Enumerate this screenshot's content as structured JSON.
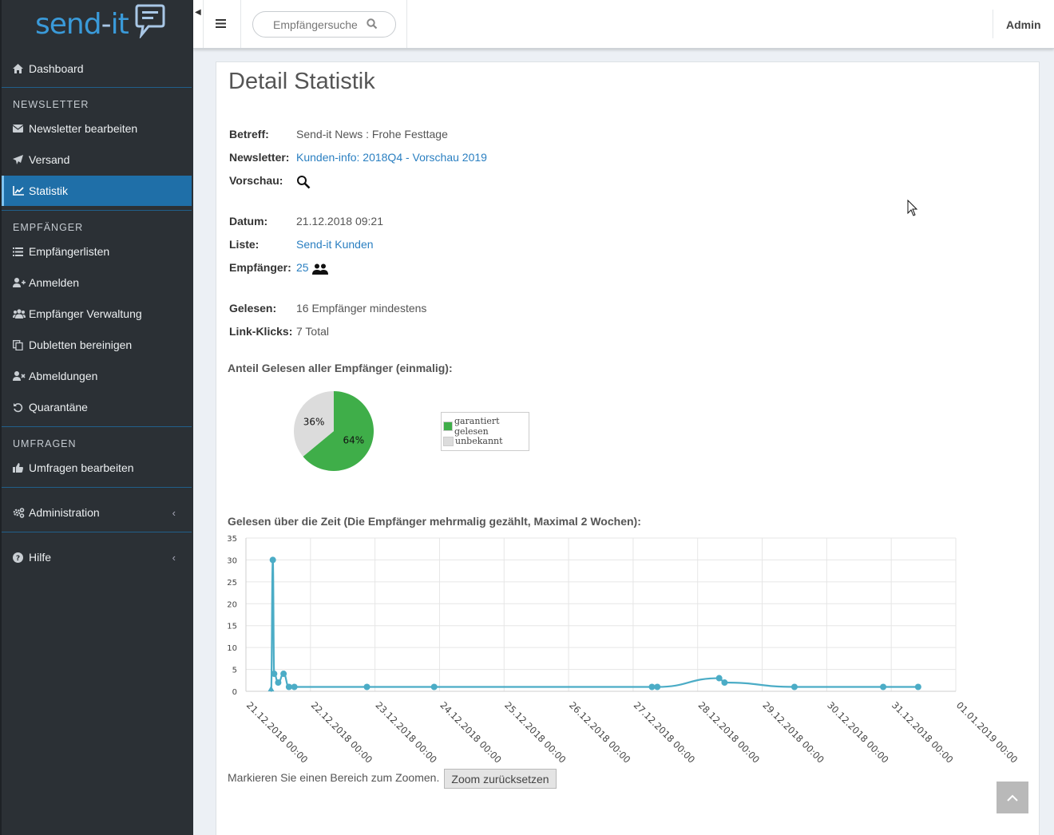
{
  "app": {
    "logo_text_a": "send",
    "logo_text_dash": "-",
    "logo_text_b": "it"
  },
  "sidebar": {
    "dashboard": "Dashboard",
    "section_newsletter": "NEWSLETTER",
    "newsletter_edit": "Newsletter bearbeiten",
    "versand": "Versand",
    "statistik": "Statistik",
    "section_empfaenger": "EMPFÄNGER",
    "empfaengerlisten": "Empfängerlisten",
    "anmelden": "Anmelden",
    "empfaenger_verwaltung": "Empfänger Verwaltung",
    "dubletten": "Dubletten bereinigen",
    "abmeldungen": "Abmeldungen",
    "quarantaene": "Quarantäne",
    "section_umfragen": "UMFRAGEN",
    "umfragen_edit": "Umfragen bearbeiten",
    "administration": "Administration",
    "hilfe": "Hilfe"
  },
  "header": {
    "search_placeholder": "Empfängersuche",
    "user": "Admin"
  },
  "detail": {
    "title": "Detail Statistik",
    "betreff_label": "Betreff:",
    "betreff": "Send-it News : Frohe Festtage",
    "newsletter_label": "Newsletter:",
    "newsletter": "Kunden-info: 2018Q4 - Vorschau 2019",
    "vorschau_label": "Vorschau:",
    "datum_label": "Datum:",
    "datum": "21.12.2018 09:21",
    "liste_label": "Liste:",
    "liste": "Send-it Kunden",
    "empfaenger_label": "Empfänger:",
    "empfaenger": "25",
    "gelesen_label": "Gelesen:",
    "gelesen": "16 Empfänger mindestens",
    "linkklicks_label": "Link-Klicks:",
    "linkklicks": "7 Total",
    "pie_heading": "Anteil Gelesen aller Empfänger (einmalig):",
    "line_heading": "Gelesen über die Zeit (Die Empfänger mehrmalig gezählt, Maximal 2 Wochen):",
    "zoom_hint": "Markieren Sie einen Bereich zum Zoomen.",
    "zoom_button": "Zoom zurücksetzen"
  },
  "colors": {
    "sidebar_bg": "#2b3035",
    "active": "#1f6fa8",
    "link": "#2a7fc1",
    "pie_read": "#3fae49",
    "pie_unknown": "#dcdcdc",
    "line": "#4bacc6"
  },
  "chart_data": [
    {
      "type": "pie",
      "slices": [
        {
          "name": "garantiert gelesen",
          "value": 64,
          "label": "64%"
        },
        {
          "name": "unbekannt",
          "value": 36,
          "label": "36%"
        }
      ],
      "legend": "right"
    },
    {
      "type": "line",
      "ylim": [
        0,
        35
      ],
      "yticks": [
        "0",
        "5",
        "10",
        "15",
        "20",
        "25",
        "30",
        "35"
      ],
      "xticks": [
        "21.12.2018 00:00",
        "22.12.2018 00:00",
        "23.12.2018 00:00",
        "24.12.2018 00:00",
        "25.12.2018 00:00",
        "26.12.2018 00:00",
        "27.12.2018 00:00",
        "28.12.2018 00:00",
        "29.12.2018 00:00",
        "30.12.2018 00:00",
        "31.12.2018 00:00",
        "01.01.2019 00:00"
      ],
      "grid": true,
      "series": [
        {
          "points": [
            {
              "x": "21.12.2018 09:21",
              "y": 0
            },
            {
              "x": "21.12.2018 10:00",
              "y": 30
            },
            {
              "x": "21.12.2018 10:30",
              "y": 4
            },
            {
              "x": "21.12.2018 12:00",
              "y": 2
            },
            {
              "x": "21.12.2018 14:00",
              "y": 4
            },
            {
              "x": "21.12.2018 16:00",
              "y": 1
            },
            {
              "x": "21.12.2018 18:00",
              "y": 1
            },
            {
              "x": "22.12.2018 21:00",
              "y": 1
            },
            {
              "x": "23.12.2018 22:00",
              "y": 1
            },
            {
              "x": "27.12.2018 07:00",
              "y": 1
            },
            {
              "x": "27.12.2018 09:00",
              "y": 1
            },
            {
              "x": "28.12.2018 08:00",
              "y": 3
            },
            {
              "x": "28.12.2018 10:00",
              "y": 2
            },
            {
              "x": "29.12.2018 12:00",
              "y": 1
            },
            {
              "x": "30.12.2018 21:00",
              "y": 1
            },
            {
              "x": "31.12.2018 10:00",
              "y": 1
            }
          ]
        }
      ]
    }
  ]
}
